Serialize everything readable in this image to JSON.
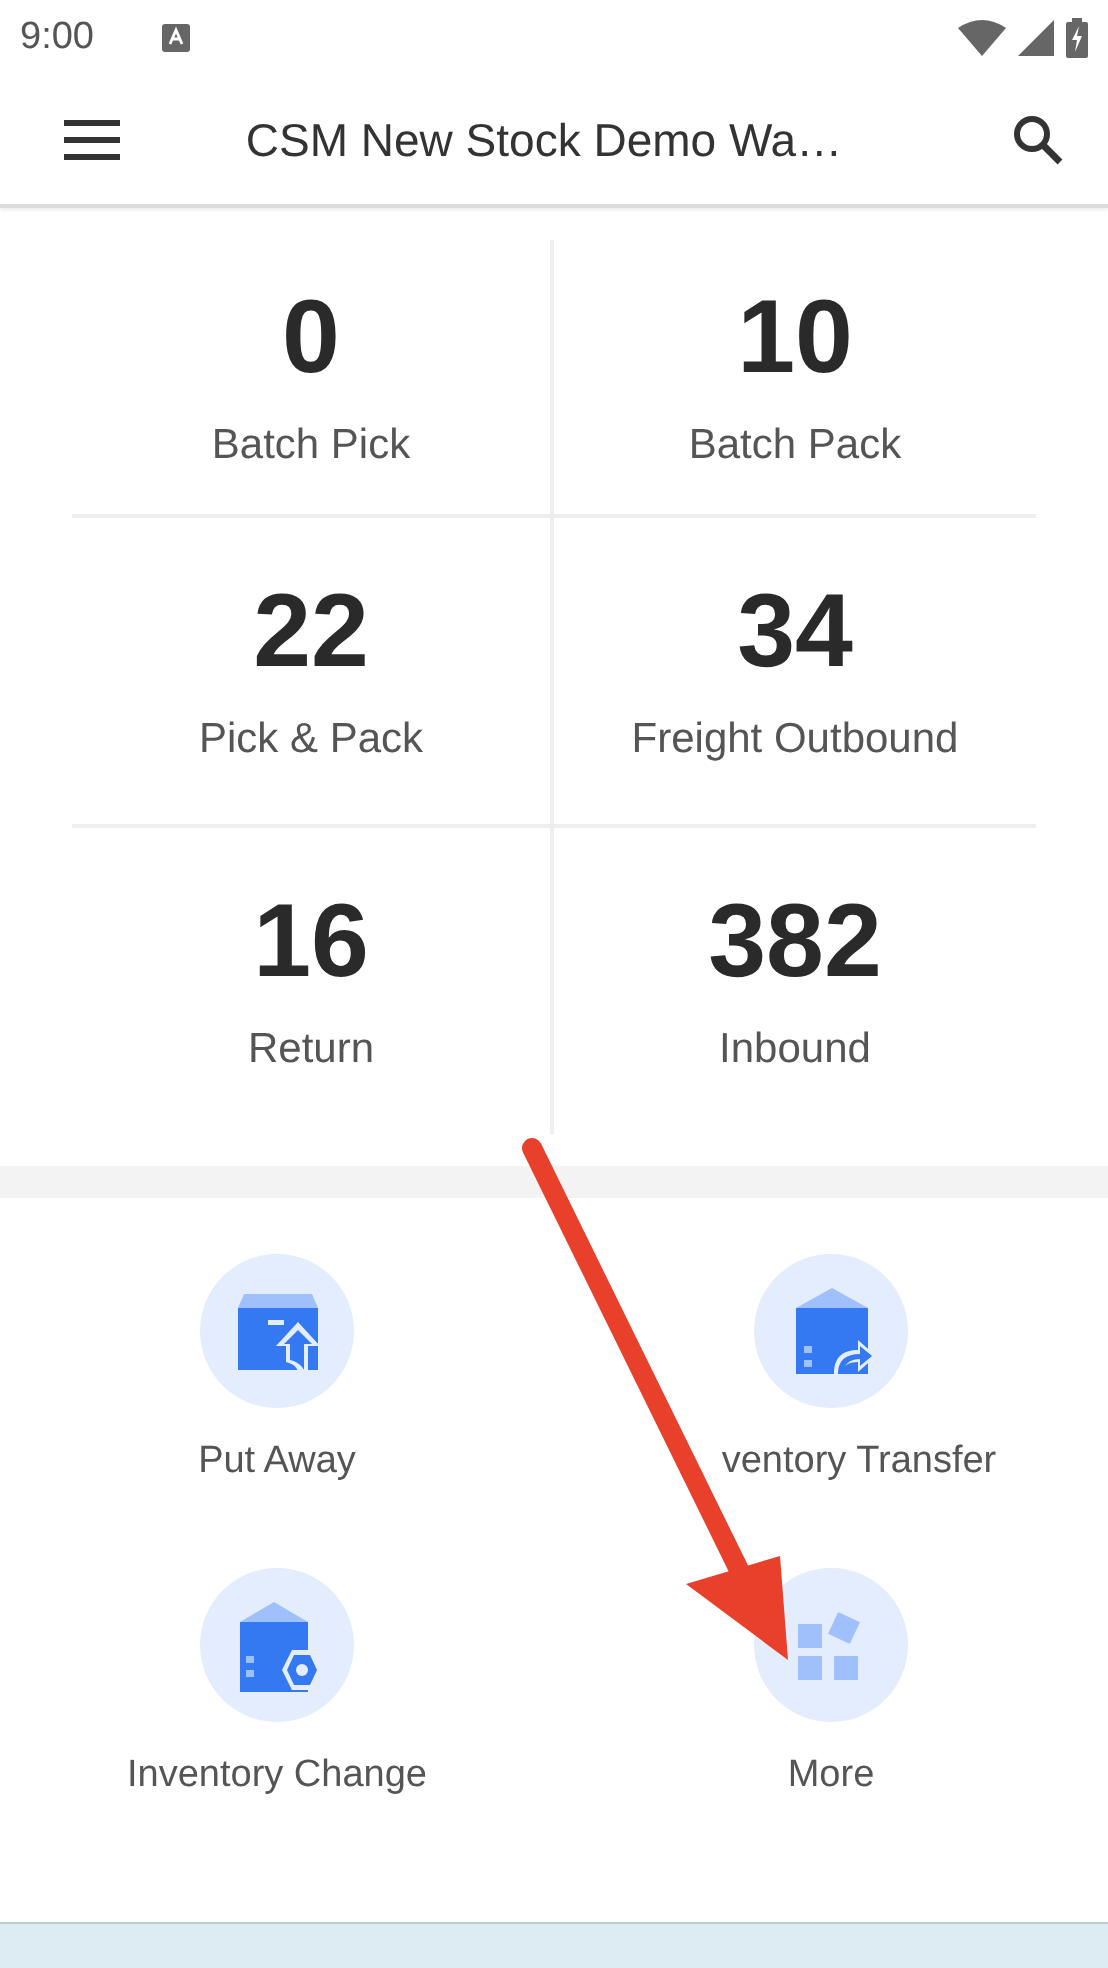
{
  "status_bar": {
    "time": "9:00"
  },
  "app_bar": {
    "title": "CSM New Stock Demo Wa…"
  },
  "stats": [
    {
      "value": "0",
      "label": "Batch Pick"
    },
    {
      "value": "10",
      "label": "Batch Pack"
    },
    {
      "value": "22",
      "label": "Pick & Pack"
    },
    {
      "value": "34",
      "label": "Freight Outbound"
    },
    {
      "value": "16",
      "label": "Return"
    },
    {
      "value": "382",
      "label": "Inbound"
    }
  ],
  "actions": [
    {
      "kind": "put-away",
      "label": "Put Away"
    },
    {
      "kind": "transfer",
      "label": "ventory Transfer"
    },
    {
      "kind": "change",
      "label": "Inventory Change"
    },
    {
      "kind": "more",
      "label": "More"
    }
  ]
}
